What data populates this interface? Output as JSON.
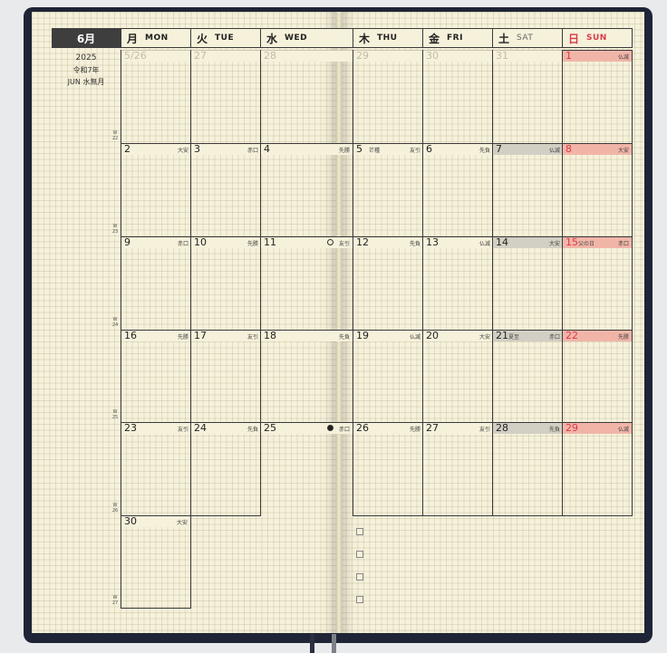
{
  "month_label": "6月",
  "side_info": {
    "year": "2025",
    "era": "令和7年",
    "month_en": "JUN  水無月"
  },
  "headers": [
    {
      "jp": "月",
      "en": "MON"
    },
    {
      "jp": "火",
      "en": "TUE"
    },
    {
      "jp": "水",
      "en": "WED"
    },
    {
      "jp": "木",
      "en": "THU"
    },
    {
      "jp": "金",
      "en": "FRI"
    },
    {
      "jp": "土",
      "en": "SAT"
    },
    {
      "jp": "日",
      "en": "SUN"
    }
  ],
  "week_labels": [
    "W 22",
    "W 23",
    "W 24",
    "W 25",
    "W 26",
    "W 27"
  ],
  "weeks": [
    [
      {
        "day": "5/26",
        "faint": true
      },
      {
        "day": "27",
        "faint": true
      },
      {
        "day": "28",
        "faint": true
      },
      {
        "day": "29",
        "faint": true
      },
      {
        "day": "30",
        "faint": true
      },
      {
        "day": "31",
        "faint": true
      },
      {
        "day": "1",
        "rokuyo": "仏滅"
      }
    ],
    [
      {
        "day": "2",
        "rokuyo": "大安"
      },
      {
        "day": "3",
        "rokuyo": "赤口"
      },
      {
        "day": "4",
        "rokuyo": "先勝"
      },
      {
        "day": "5",
        "rokuyo": "友引",
        "holiday": "芒種"
      },
      {
        "day": "6",
        "rokuyo": "先負"
      },
      {
        "day": "7",
        "rokuyo": "仏滅"
      },
      {
        "day": "8",
        "rokuyo": "大安"
      }
    ],
    [
      {
        "day": "9",
        "rokuyo": "赤口"
      },
      {
        "day": "10",
        "rokuyo": "先勝"
      },
      {
        "day": "11",
        "rokuyo": "友引",
        "moon": "new"
      },
      {
        "day": "12",
        "rokuyo": "先負"
      },
      {
        "day": "13",
        "rokuyo": "仏滅"
      },
      {
        "day": "14",
        "rokuyo": "大安"
      },
      {
        "day": "15",
        "rokuyo": "赤口",
        "holiday": "父の日"
      }
    ],
    [
      {
        "day": "16",
        "rokuyo": "先勝"
      },
      {
        "day": "17",
        "rokuyo": "友引"
      },
      {
        "day": "18",
        "rokuyo": "先負"
      },
      {
        "day": "19",
        "rokuyo": "仏滅"
      },
      {
        "day": "20",
        "rokuyo": "大安"
      },
      {
        "day": "21",
        "rokuyo": "赤口",
        "holiday": "夏至"
      },
      {
        "day": "22",
        "rokuyo": "先勝"
      }
    ],
    [
      {
        "day": "23",
        "rokuyo": "友引"
      },
      {
        "day": "24",
        "rokuyo": "先負"
      },
      {
        "day": "25",
        "rokuyo": "赤口",
        "moon": "full"
      },
      {
        "day": "26",
        "rokuyo": "先勝"
      },
      {
        "day": "27",
        "rokuyo": "友引"
      },
      {
        "day": "28",
        "rokuyo": "先負"
      },
      {
        "day": "29",
        "rokuyo": "仏滅"
      }
    ],
    [
      {
        "day": "30",
        "rokuyo": "大安"
      }
    ]
  ],
  "colors": {
    "cover": "#1f2436",
    "paper": "#f6f1da",
    "sunday": "#d93a4a",
    "sun_band": "#f1b5a8",
    "sat_band": "#d2cfc4",
    "month_header": "#3e3e3e"
  }
}
